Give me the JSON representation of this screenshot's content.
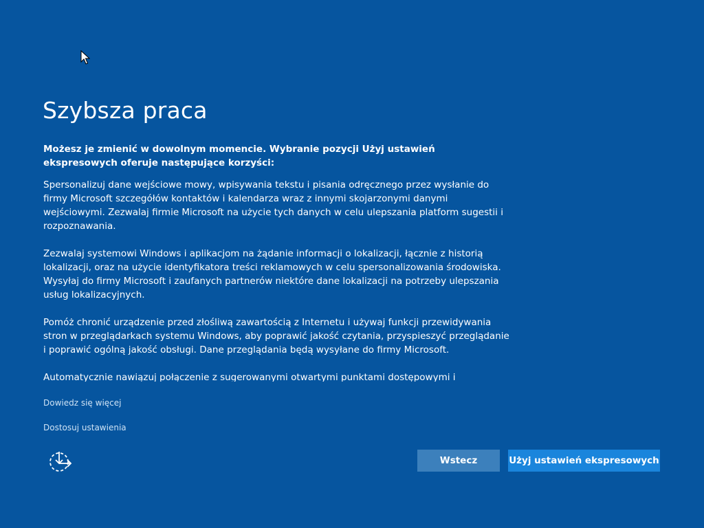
{
  "page": {
    "title": "Szybsza praca",
    "intro": "Możesz je zmienić w dowolnym momencie. Wybranie pozycji Użyj ustawień ekspresowych oferuje następujące korzyści:",
    "paragraphs": [
      "Spersonalizuj dane wejściowe mowy, wpisywania tekstu i pisania odręcznego przez wysłanie do firmy Microsoft szczegółów kontaktów i kalendarza wraz z innymi skojarzonymi danymi wejściowymi. Zezwalaj firmie Microsoft na użycie tych danych w celu ulepszania platform sugestii i rozpoznawania.",
      "Zezwalaj systemowi Windows i aplikacjom na żądanie informacji o lokalizacji, łącznie z historią lokalizacji, oraz na użycie identyfikatora treści reklamowych w celu spersonalizowania środowiska. Wysyłaj do firmy Microsoft i zaufanych partnerów niektóre dane lokalizacji na potrzeby ulepszania usług lokalizacyjnych.",
      "Pomóż chronić urządzenie przed złośliwą zawartością z Internetu i używaj funkcji przewidywania stron w przeglądarkach systemu Windows, aby poprawić jakość czytania, przyspieszyć przeglądanie i poprawić ogólną jakość obsługi. Dane przeglądania będą wysyłane do firmy Microsoft.",
      "Automatycznie nawiązuj połączenie z sugerowanymi otwartymi punktami dostępowymi i"
    ]
  },
  "links": {
    "learn_more": "Dowiedz się więcej",
    "customize": "Dostosuj ustawienia"
  },
  "buttons": {
    "back": "Wstecz",
    "express": "Użyj ustawień ekspresowych"
  },
  "icons": {
    "accessibility": "ease-of-access-icon",
    "cursor": "mouse-pointer-icon"
  },
  "colors": {
    "background": "#06559f",
    "back_button": "#3c80bc",
    "express_button": "#1a85dc",
    "text": "#ffffff",
    "link": "#cfe3f5"
  }
}
